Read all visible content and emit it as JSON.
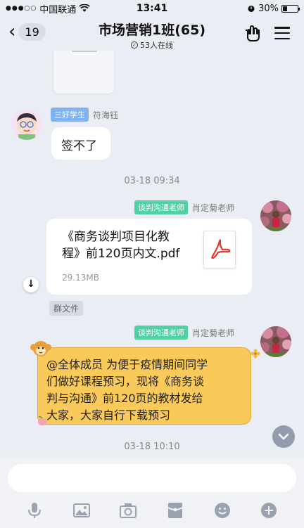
{
  "status_bar": {
    "carrier": "中国联通",
    "time": "13:41",
    "battery": "30%",
    "battery_level": 0.3
  },
  "header": {
    "back_count": "19",
    "title": "市场营销1班(65)",
    "online": "53人在线"
  },
  "messages": [
    {
      "badge": "三好学生",
      "sender": "符海钰",
      "text": "签不了"
    },
    {
      "timestamp": "03-18 09:34"
    },
    {
      "badge": "谈判沟通老师",
      "sender": "肖定菊老师",
      "file_name": "《商务谈判项目化教程》前120页内文.pdf",
      "file_name_lines": [
        "《商务谈判项目化教",
        "程》前120页内文.pdf"
      ],
      "file_size": "29.13MB",
      "tag": "群文件"
    },
    {
      "badge": "谈判沟通老师",
      "sender": "肖定菊老师",
      "text_lines": [
        "@全体成员 为便于疫情期间同学",
        "们做好课程预习，现将《商务谈",
        "判与沟通》前120页的教材发给",
        "大家，大家自行下载预习"
      ]
    },
    {
      "timestamp": "03-18 10:10"
    }
  ],
  "input": {
    "placeholder": ""
  },
  "toolbar": {
    "icons": [
      "microphone-icon",
      "image-icon",
      "camera-icon",
      "red-packet-icon",
      "emoji-icon",
      "plus-icon"
    ]
  },
  "colors": {
    "background": "#eaedf4",
    "badge_blue": "#7fb2f0",
    "badge_green": "#4fd0a5",
    "bubble_yellow": "#f9c95a",
    "pdf_red": "#e0392f"
  }
}
